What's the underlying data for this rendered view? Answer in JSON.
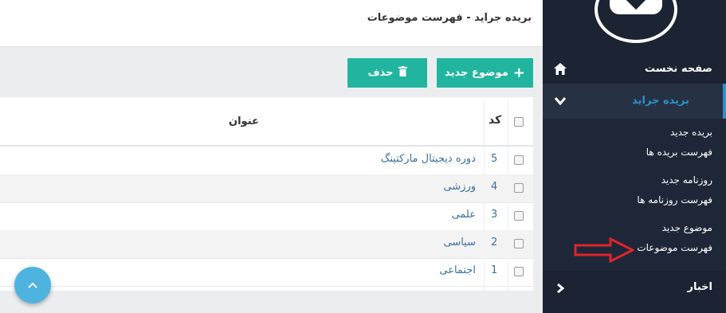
{
  "header": {
    "title": "بریده جراید - فهرست موضوعات"
  },
  "toolbar": {
    "new_label": "موضوع جدید",
    "delete_label": "حذف"
  },
  "table": {
    "headers": {
      "code": "کد",
      "title": "عنوان"
    },
    "rows": [
      {
        "code": "5",
        "title": "دوره دیجیتال مارکتینگ"
      },
      {
        "code": "4",
        "title": "ورزشی"
      },
      {
        "code": "3",
        "title": "علمی"
      },
      {
        "code": "2",
        "title": "سیاسی"
      },
      {
        "code": "1",
        "title": "اجتماعی"
      }
    ]
  },
  "sidebar": {
    "home": "صفحه نخست",
    "active_section": "بریده جراید",
    "sub_items": [
      "بریده جدید",
      "فهرست بریده ها",
      "روزنامه جدید",
      "فهرست روزنامه ها",
      "موضوع جدید",
      "فهرست موضوعات"
    ],
    "news": "اخبار"
  },
  "colors": {
    "sidebar_bg": "#1c2332",
    "accent": "#2a93c9",
    "button": "#21b5a0",
    "fab": "#4fb3e0",
    "annotation_arrow": "#e0242b"
  },
  "icons": {
    "home": "home-icon",
    "expand": "chevron-down-icon",
    "collapse": "chevron-left-icon",
    "add": "plus-icon",
    "delete": "trash-icon",
    "scroll_top": "chevron-up-icon"
  }
}
